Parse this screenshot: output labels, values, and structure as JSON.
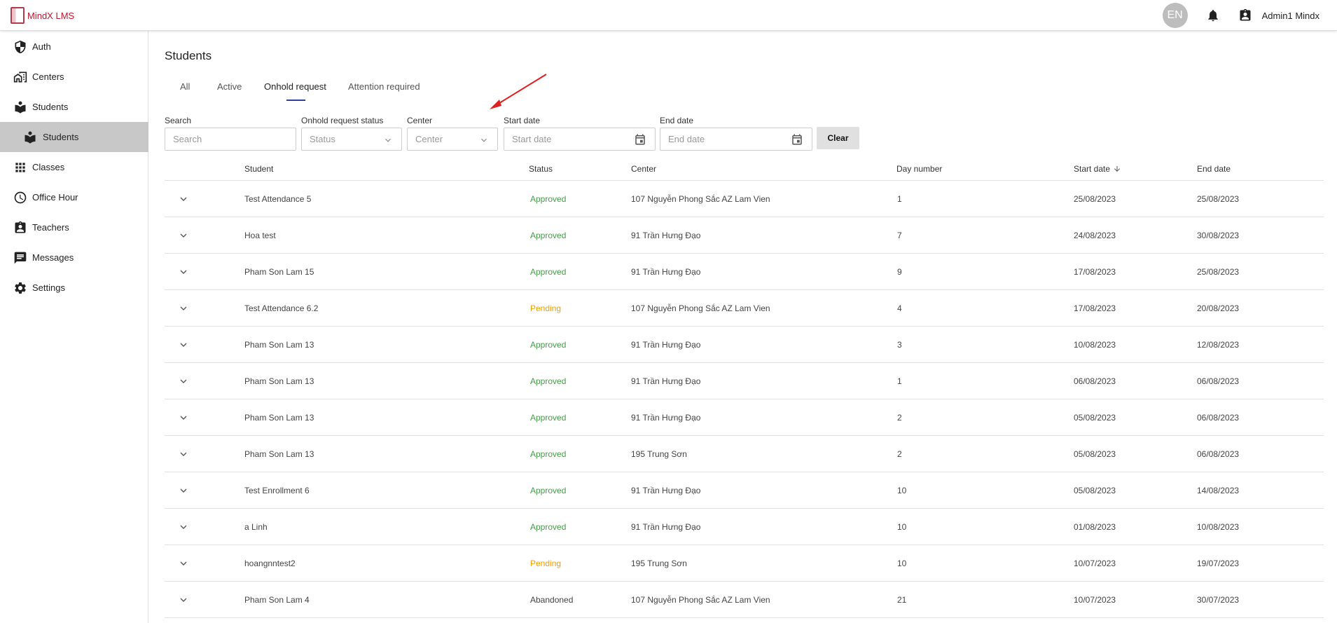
{
  "app": {
    "name": "MindX LMS"
  },
  "topbar": {
    "lang": "EN",
    "user_name": "Admin1 Mindx"
  },
  "sidebar": {
    "items": [
      {
        "label": "Auth",
        "icon": "shield-icon"
      },
      {
        "label": "Centers",
        "icon": "building-icon"
      },
      {
        "label": "Students",
        "icon": "student-icon"
      },
      {
        "label": "Students",
        "icon": "student-icon"
      },
      {
        "label": "Classes",
        "icon": "grid-icon"
      },
      {
        "label": "Office Hour",
        "icon": "clock-icon"
      },
      {
        "label": "Teachers",
        "icon": "badge-icon"
      },
      {
        "label": "Messages",
        "icon": "message-icon"
      },
      {
        "label": "Settings",
        "icon": "gear-icon"
      }
    ]
  },
  "page": {
    "title": "Students"
  },
  "tabs": [
    {
      "label": "All"
    },
    {
      "label": "Active"
    },
    {
      "label": "Onhold request"
    },
    {
      "label": "Attention required"
    }
  ],
  "filters": {
    "search": {
      "label": "Search",
      "placeholder": "Search"
    },
    "status": {
      "label": "Onhold request status",
      "placeholder": "Status"
    },
    "center": {
      "label": "Center",
      "placeholder": "Center"
    },
    "start_date": {
      "label": "Start date",
      "placeholder": "Start date"
    },
    "end_date": {
      "label": "End date",
      "placeholder": "End date"
    },
    "clear_label": "Clear"
  },
  "table": {
    "columns": [
      "Student",
      "Status",
      "Center",
      "Day number",
      "Start date",
      "End date"
    ],
    "rows": [
      {
        "student": "Test Attendance 5",
        "status": "Approved",
        "center": "107 Nguyễn Phong Sắc AZ Lam Vien",
        "days": "1",
        "start": "25/08/2023",
        "end": "25/08/2023"
      },
      {
        "student": "Hoa test",
        "status": "Approved",
        "center": "91 Trần Hưng Đạo",
        "days": "7",
        "start": "24/08/2023",
        "end": "30/08/2023"
      },
      {
        "student": "Pham Son Lam 15",
        "status": "Approved",
        "center": "91 Trần Hưng Đạo",
        "days": "9",
        "start": "17/08/2023",
        "end": "25/08/2023"
      },
      {
        "student": "Test Attendance 6.2",
        "status": "Pending",
        "center": "107 Nguyễn Phong Sắc AZ Lam Vien",
        "days": "4",
        "start": "17/08/2023",
        "end": "20/08/2023"
      },
      {
        "student": "Pham Son Lam 13",
        "status": "Approved",
        "center": "91 Trần Hưng Đạo",
        "days": "3",
        "start": "10/08/2023",
        "end": "12/08/2023"
      },
      {
        "student": "Pham Son Lam 13",
        "status": "Approved",
        "center": "91 Trần Hưng Đạo",
        "days": "1",
        "start": "06/08/2023",
        "end": "06/08/2023"
      },
      {
        "student": "Pham Son Lam 13",
        "status": "Approved",
        "center": "91 Trần Hưng Đạo",
        "days": "2",
        "start": "05/08/2023",
        "end": "06/08/2023"
      },
      {
        "student": "Pham Son Lam 13",
        "status": "Approved",
        "center": "195 Trung Sơn",
        "days": "2",
        "start": "05/08/2023",
        "end": "06/08/2023"
      },
      {
        "student": "Test Enrollment 6",
        "status": "Approved",
        "center": "91 Trần Hưng Đạo",
        "days": "10",
        "start": "05/08/2023",
        "end": "14/08/2023"
      },
      {
        "student": "a Linh",
        "status": "Approved",
        "center": "91 Trần Hưng Đạo",
        "days": "10",
        "start": "01/08/2023",
        "end": "10/08/2023"
      },
      {
        "student": "hoangnntest2",
        "status": "Pending",
        "center": "195 Trung Sơn",
        "days": "10",
        "start": "10/07/2023",
        "end": "19/07/2023"
      },
      {
        "student": "Pham Son Lam 4",
        "status": "Abandoned",
        "center": "107 Nguyễn Phong Sắc AZ Lam Vien",
        "days": "21",
        "start": "10/07/2023",
        "end": "30/07/2023"
      }
    ]
  },
  "colors": {
    "approved": "#43a047",
    "pending": "#f59f00",
    "brand": "#c0162c",
    "tab_indicator": "#2f3fa0",
    "annotation_arrow": "#e02020"
  }
}
